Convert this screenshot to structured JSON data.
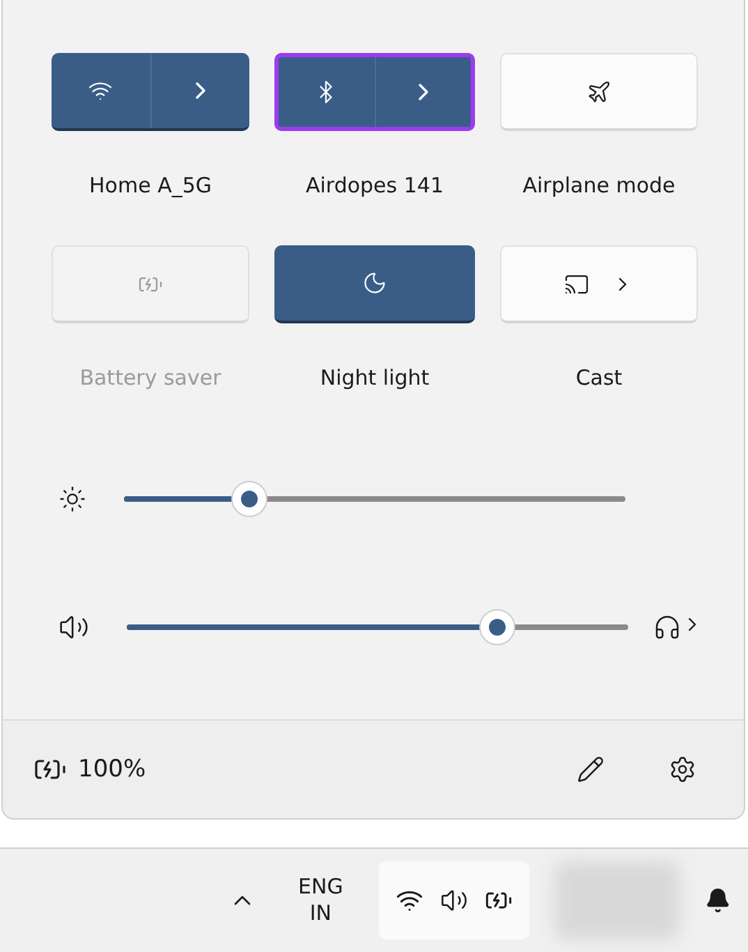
{
  "tiles": [
    {
      "kind": "split",
      "label": "Home A_5G",
      "on": true,
      "disabled": false,
      "focused": false
    },
    {
      "kind": "split",
      "label": "Airdopes 141",
      "on": true,
      "disabled": false,
      "focused": true
    },
    {
      "kind": "single",
      "label": "Airplane mode",
      "on": false,
      "disabled": false,
      "focused": false
    },
    {
      "kind": "single",
      "label": "Battery saver",
      "on": false,
      "disabled": true,
      "focused": false
    },
    {
      "kind": "single",
      "label": "Night light",
      "on": true,
      "disabled": false,
      "focused": false
    },
    {
      "kind": "expand",
      "label": "Cast",
      "on": false,
      "disabled": false,
      "focused": false
    }
  ],
  "sliders": [
    {
      "kind": "brightness",
      "level": 0.25
    },
    {
      "kind": "volume",
      "level": 0.74
    }
  ],
  "battery": {
    "reading": "100%"
  },
  "taskbar": {
    "language": "ENG",
    "region": "IN"
  }
}
